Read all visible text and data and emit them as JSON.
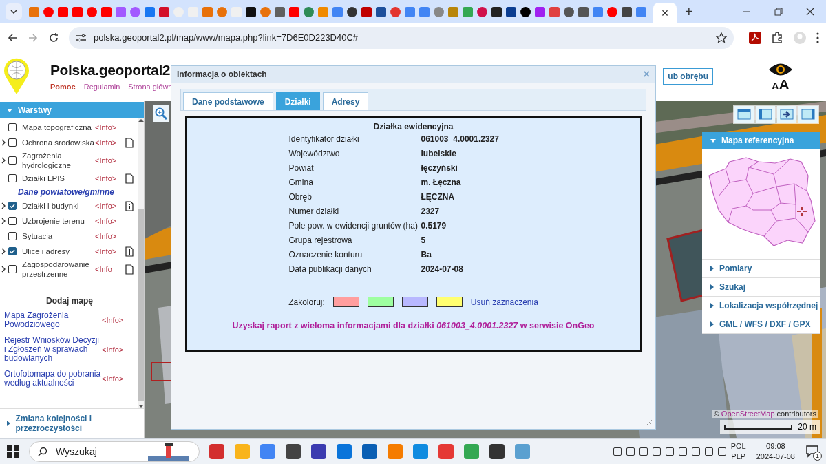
{
  "browser": {
    "tab_close": "×",
    "new_tab": "+",
    "url": "polska.geoportal2.pl/map/www/mapa.php?link=7D6E0D223D40C#"
  },
  "header": {
    "title": "Polska.geoportal2",
    "links": [
      {
        "label": "Pomoc",
        "color": "#c0392b"
      },
      {
        "label": "Regulamin",
        "color": "#b0449a"
      },
      {
        "label": "Strona główn",
        "color": "#b0449a"
      }
    ],
    "search_button": "ub obrębu",
    "text_size": "AA"
  },
  "sidebar": {
    "title": "Warstwy",
    "layers": [
      {
        "kind": "layer",
        "label": "Mapa topograficzna",
        "expandable": false,
        "checked": false,
        "info": "<Info>",
        "doc": false
      },
      {
        "kind": "layer",
        "label": "Ochrona środowiska",
        "expandable": true,
        "checked": false,
        "info": "<Info>",
        "doc": true,
        "doc_info": false
      },
      {
        "kind": "layer",
        "label": "Zagrożenia hydrologiczne",
        "expandable": true,
        "checked": false,
        "info": "<Info>",
        "doc": false
      },
      {
        "kind": "layer",
        "label": "Działki LPIS",
        "expandable": false,
        "checked": false,
        "info": "<Info>",
        "doc": true,
        "doc_info": false
      },
      {
        "kind": "heading",
        "label": "Dane powiatowe/gminne"
      },
      {
        "kind": "layer",
        "label": "Działki i budynki",
        "expandable": true,
        "checked": true,
        "info": "<Info>",
        "doc": true,
        "doc_info": true
      },
      {
        "kind": "layer",
        "label": "Uzbrojenie terenu",
        "expandable": true,
        "checked": false,
        "info": "<Info>",
        "doc": false
      },
      {
        "kind": "layer",
        "label": "Sytuacja",
        "expandable": false,
        "checked": false,
        "info": "<Info>",
        "doc": false
      },
      {
        "kind": "layer",
        "label": "Ulice i adresy",
        "expandable": true,
        "checked": true,
        "info": "<Info>",
        "doc": true,
        "doc_info": true
      },
      {
        "kind": "layer",
        "label": "Zagospodarowanie przestrzenne",
        "expandable": true,
        "checked": false,
        "info": "<Info",
        "doc": true,
        "doc_info": false
      }
    ],
    "add_map_title": "Dodaj mapę",
    "maps": [
      {
        "label": "Mapa Zagrożenia Powodziowego",
        "info": "<Info>"
      },
      {
        "label": "Rejestr Wniosków Decyzji i Zgłoszeń w sprawach budowlanych",
        "info": "<Info>"
      },
      {
        "label": "Ortofotomapa do pobrania według aktualności",
        "info": "<Info>"
      }
    ],
    "footer": "Zmiana kolejności i przezroczystości"
  },
  "map": {
    "attribution": {
      "prefix": "©",
      "link": "OpenStreetMap",
      "suffix": "contributors"
    },
    "scale": "20 m"
  },
  "right_panel": {
    "title": "Mapa referencyjna",
    "items": [
      "Pomiary",
      "Szukaj",
      "Lokalizacja współrzędnej",
      "GML / WFS / DXF / GPX"
    ]
  },
  "dialog": {
    "title": "Informacja o obiektach",
    "close": "×",
    "tabs": [
      {
        "label": "Dane podstawowe",
        "selected": false
      },
      {
        "label": "Działki",
        "selected": true
      },
      {
        "label": "Adresy",
        "selected": false
      }
    ],
    "heading": "Działka ewidencyjna",
    "rows": [
      {
        "label": "Identyfikator działki",
        "value": "061003_4.0001.2327"
      },
      {
        "label": "Województwo",
        "value": "lubelskie"
      },
      {
        "label": "Powiat",
        "value": "łęczyński"
      },
      {
        "label": "Gmina",
        "value": "m. Łęczna"
      },
      {
        "label": "Obręb",
        "value": "ŁĘCZNA"
      },
      {
        "label": "Numer działki",
        "value": "2327"
      },
      {
        "label": "Pole pow. w ewidencji gruntów (ha)",
        "value": "0.5179"
      },
      {
        "label": "Grupa rejestrowa",
        "value": "5"
      },
      {
        "label": "Oznaczenie konturu",
        "value": "Ba"
      },
      {
        "label": "Data publikacji danych",
        "value": "2024-07-08"
      }
    ],
    "colorize_label": "Zakoloruj:",
    "swatches": [
      {
        "color": "#ff9e9e"
      },
      {
        "color": "#9effa0"
      },
      {
        "color": "#b8b8ff"
      },
      {
        "color": "#ffff70"
      }
    ],
    "clear_link": "Usuń zaznaczenia",
    "report": "Uzyskaj raport z wieloma informacjami dla działki *061003_4.0001.2327* w serwisie OnGeo"
  },
  "taskbar": {
    "search_placeholder": "Wyszukaj",
    "lang": "POL",
    "layout": "PLP",
    "time": "09:08",
    "date": "2024-07-08",
    "notifications": "1"
  }
}
